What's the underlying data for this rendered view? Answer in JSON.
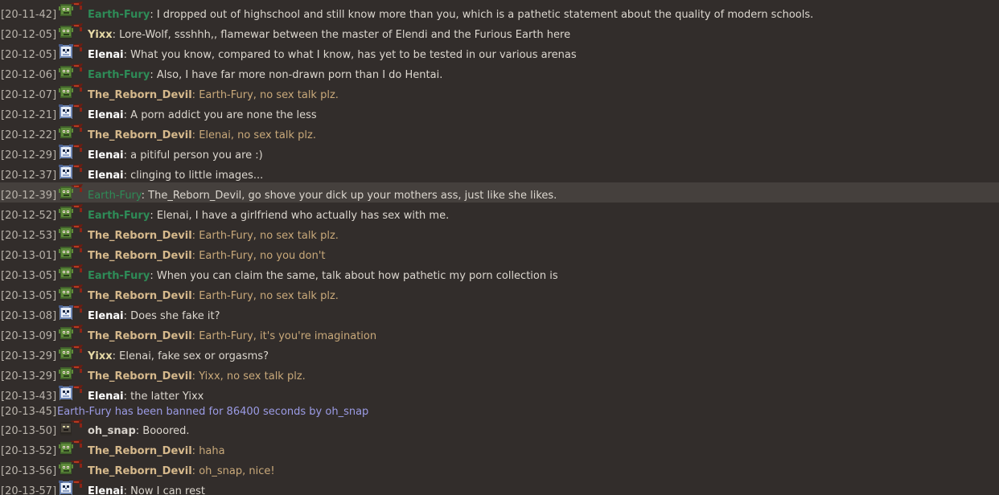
{
  "colors": {
    "background": "#322d2b",
    "highlight_row": "#45403d",
    "timestamp": "#b9b3ab",
    "text_default": "#dcd7cf",
    "text_mod_message": "#c9a97a",
    "system_message": "#9c9ce6",
    "name_earth_fury": "#2e8b57",
    "name_reborn_devil": "#d6b98c",
    "name_yixx": "#e6d9a6",
    "name_elenai": "#ffffff",
    "name_oh_snap": "#d8d3cc"
  },
  "messages": [
    {
      "type": "chat",
      "time": "[20-11-42]",
      "avatar": "green-goblin-avatar-icon",
      "name": "Earth-Fury",
      "sep": ":",
      "text": " I dropped out of highschool and still know more than you, which is a pathetic statement about the quality of modern schools.",
      "name_color": "#2e8b57",
      "text_color": "#dcd7cf",
      "bold": true
    },
    {
      "type": "chat",
      "time": "[20-12-05]",
      "avatar": "green-goblin-avatar-icon",
      "name": "Yixx",
      "sep": ":",
      "text": " Lore-Wolf, ssshhh,, flamewar between the master of Elendi and the Furious Earth here",
      "name_color": "#e6d9a6",
      "text_color": "#dcd7cf",
      "bold": true
    },
    {
      "type": "chat",
      "time": "[20-12-05]",
      "avatar": "skull-mage-avatar-icon",
      "name": "Elenai",
      "sep": ":",
      "text": " What you know, compared to what I know, has yet to be tested in our various arenas",
      "name_color": "#ffffff",
      "text_color": "#dcd7cf",
      "bold": true
    },
    {
      "type": "chat",
      "time": "[20-12-06]",
      "avatar": "green-goblin-avatar-icon",
      "name": "Earth-Fury",
      "sep": ":",
      "text": " Also, I have far more non-drawn porn than I do Hentai.",
      "name_color": "#2e8b57",
      "text_color": "#dcd7cf",
      "bold": true
    },
    {
      "type": "chat",
      "time": "[20-12-07]",
      "avatar": "green-goblin-avatar-icon",
      "name": "The_Reborn_Devil",
      "sep": ":",
      "text": " Earth-Fury, no sex talk plz.",
      "name_color": "#d6b98c",
      "text_color": "#c9a97a",
      "bold": true
    },
    {
      "type": "chat",
      "time": "[20-12-21]",
      "avatar": "skull-mage-avatar-icon",
      "name": "Elenai",
      "sep": ":",
      "text": " A porn addict you are none the less",
      "name_color": "#ffffff",
      "text_color": "#dcd7cf",
      "bold": true
    },
    {
      "type": "chat",
      "time": "[20-12-22]",
      "avatar": "green-goblin-avatar-icon",
      "name": "The_Reborn_Devil",
      "sep": ":",
      "text": " Elenai, no sex talk plz.",
      "name_color": "#d6b98c",
      "text_color": "#c9a97a",
      "bold": true
    },
    {
      "type": "chat",
      "time": "[20-12-29]",
      "avatar": "skull-mage-avatar-icon",
      "name": "Elenai",
      "sep": ":",
      "text": " a pitiful person you are :)",
      "name_color": "#ffffff",
      "text_color": "#dcd7cf",
      "bold": true
    },
    {
      "type": "chat",
      "time": "[20-12-37]",
      "avatar": "skull-mage-avatar-icon",
      "name": "Elenai",
      "sep": ":",
      "text": " clinging to little images...",
      "name_color": "#ffffff",
      "text_color": "#dcd7cf",
      "bold": true
    },
    {
      "type": "chat",
      "time": "[20-12-39]",
      "avatar": "green-goblin-avatar-icon",
      "name": "Earth-Fury",
      "sep": ":",
      "text": " The_Reborn_Devil, go shove your dick up your mothers ass, just like she likes.",
      "name_color": "#2e8b57",
      "text_color": "#dcd7cf",
      "bold": false,
      "highlight": true
    },
    {
      "type": "chat",
      "time": "[20-12-52]",
      "avatar": "green-goblin-avatar-icon",
      "name": "Earth-Fury",
      "sep": ":",
      "text": " Elenai, I have a girlfriend who actually has sex with me.",
      "name_color": "#2e8b57",
      "text_color": "#dcd7cf",
      "bold": true
    },
    {
      "type": "chat",
      "time": "[20-12-53]",
      "avatar": "green-goblin-avatar-icon",
      "name": "The_Reborn_Devil",
      "sep": ":",
      "text": " Earth-Fury, no sex talk plz.",
      "name_color": "#d6b98c",
      "text_color": "#c9a97a",
      "bold": true
    },
    {
      "type": "chat",
      "time": "[20-13-01]",
      "avatar": "green-goblin-avatar-icon",
      "name": "The_Reborn_Devil",
      "sep": ":",
      "text": " Earth-Fury, no you don't",
      "name_color": "#d6b98c",
      "text_color": "#c9a97a",
      "bold": true
    },
    {
      "type": "chat",
      "time": "[20-13-05]",
      "avatar": "green-goblin-avatar-icon",
      "name": "Earth-Fury",
      "sep": ":",
      "text": " When you can claim the same, talk about how pathetic my porn collection is",
      "name_color": "#2e8b57",
      "text_color": "#dcd7cf",
      "bold": true
    },
    {
      "type": "chat",
      "time": "[20-13-05]",
      "avatar": "green-goblin-avatar-icon",
      "name": "The_Reborn_Devil",
      "sep": ":",
      "text": " Earth-Fury, no sex talk plz.",
      "name_color": "#d6b98c",
      "text_color": "#c9a97a",
      "bold": true
    },
    {
      "type": "chat",
      "time": "[20-13-08]",
      "avatar": "skull-mage-avatar-icon",
      "name": "Elenai",
      "sep": ":",
      "text": " Does she fake it?",
      "name_color": "#ffffff",
      "text_color": "#dcd7cf",
      "bold": true
    },
    {
      "type": "chat",
      "time": "[20-13-09]",
      "avatar": "green-goblin-avatar-icon",
      "name": "The_Reborn_Devil",
      "sep": ":",
      "text": " Earth-Fury, it's you're imagination",
      "name_color": "#d6b98c",
      "text_color": "#c9a97a",
      "bold": true
    },
    {
      "type": "chat",
      "time": "[20-13-29]",
      "avatar": "green-goblin-avatar-icon",
      "name": "Yixx",
      "sep": ":",
      "text": " Elenai, fake sex or orgasms?",
      "name_color": "#e6d9a6",
      "text_color": "#dcd7cf",
      "bold": true
    },
    {
      "type": "chat",
      "time": "[20-13-29]",
      "avatar": "green-goblin-avatar-icon",
      "name": "The_Reborn_Devil",
      "sep": ":",
      "text": " Yixx, no sex talk plz.",
      "name_color": "#d6b98c",
      "text_color": "#c9a97a",
      "bold": true
    },
    {
      "type": "chat",
      "time": "[20-13-43]",
      "avatar": "skull-mage-avatar-icon",
      "name": "Elenai",
      "sep": ":",
      "text": " the latter Yixx",
      "name_color": "#ffffff",
      "text_color": "#dcd7cf",
      "bold": true
    },
    {
      "type": "system",
      "time": "[20-13-45]",
      "text": "Earth-Fury has been banned for 86400 seconds by oh_snap",
      "text_color": "#9c9ce6"
    },
    {
      "type": "chat",
      "time": "[20-13-50]",
      "avatar": "dark-mask-avatar-icon",
      "name": "oh_snap",
      "sep": ":",
      "text": " Booored.",
      "name_color": "#d8d3cc",
      "text_color": "#dcd7cf",
      "bold": true
    },
    {
      "type": "chat",
      "time": "[20-13-52]",
      "avatar": "green-goblin-avatar-icon",
      "name": "The_Reborn_Devil",
      "sep": ":",
      "text": " haha",
      "name_color": "#d6b98c",
      "text_color": "#c9a97a",
      "bold": true
    },
    {
      "type": "chat",
      "time": "[20-13-56]",
      "avatar": "green-goblin-avatar-icon",
      "name": "The_Reborn_Devil",
      "sep": ":",
      "text": " oh_snap, nice!",
      "name_color": "#d6b98c",
      "text_color": "#c9a97a",
      "bold": true
    },
    {
      "type": "chat",
      "time": "[20-13-57]",
      "avatar": "skull-mage-avatar-icon",
      "name": "Elenai",
      "sep": ":",
      "text": " Now I can rest",
      "name_color": "#ffffff",
      "text_color": "#dcd7cf",
      "bold": true
    }
  ]
}
